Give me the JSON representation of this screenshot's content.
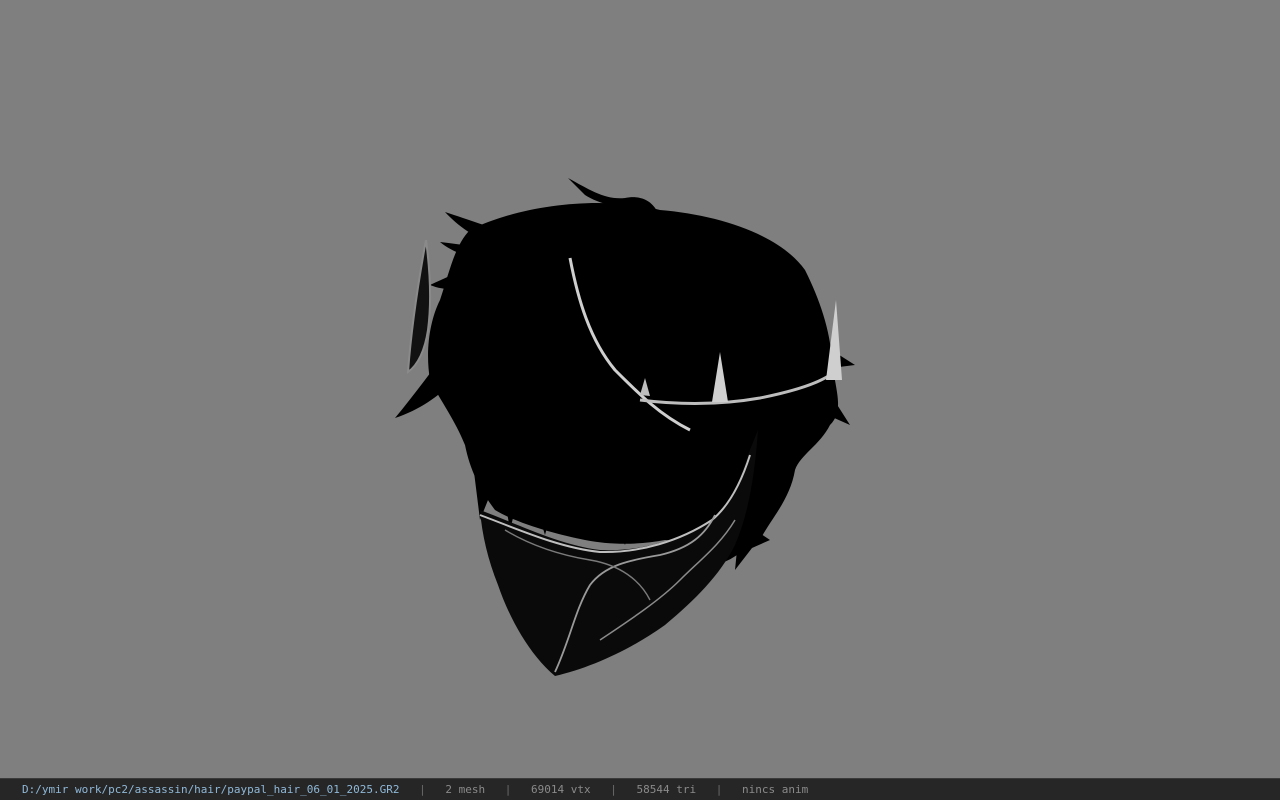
{
  "viewport": {
    "background_color": "#7f7f7f",
    "model": "hair mesh with mask"
  },
  "status_bar": {
    "file_path": "D:/ymir work/pc2/assassin/hair/paypal_hair_06_01_2025.GR2",
    "separator": "|",
    "mesh_count": "2 mesh",
    "vertex_count": "69014 vtx",
    "triangle_count": "58544 tri",
    "animation": "nincs anim"
  },
  "colors": {
    "status_bar_bg": "#262626",
    "path_text": "#8fb8d8",
    "info_text": "#8a8a8a"
  }
}
